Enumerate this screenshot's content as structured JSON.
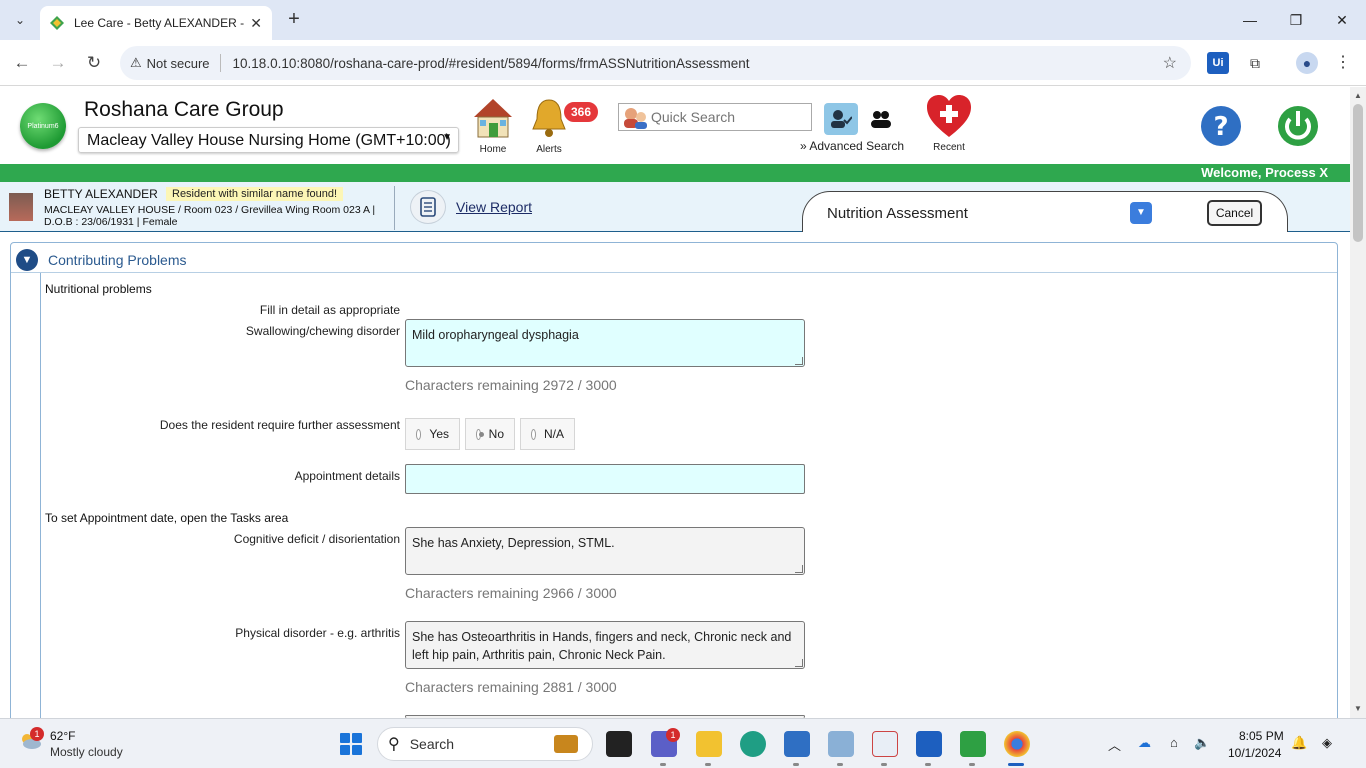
{
  "browser": {
    "tab_title": "Lee Care - Betty ALEXANDER - ",
    "security_label": "Not secure",
    "url": "10.18.0.10:8080/roshana-care-prod/#resident/5894/forms/frmASSNutritionAssessment"
  },
  "header": {
    "logo_text": "Platinum6",
    "org_name": "Roshana Care Group",
    "facility": "Macleay Valley House Nursing Home (GMT+10:00)",
    "home_label": "Home",
    "alerts_label": "Alerts",
    "alerts_count": "366",
    "quick_search_placeholder": "Quick Search",
    "advanced_search_label": "Advanced Search",
    "recent_label": "Recent"
  },
  "welcome": "Welcome, Process X",
  "resident": {
    "name": "BETTY ALEXANDER",
    "warning": "Resident with similar name found!",
    "location": "MACLEAY VALLEY HOUSE / Room 023 / Grevillea Wing Room 023 A | D.O.B : 23/06/1931 | Female",
    "view_report": "View Report"
  },
  "form": {
    "title": "Nutrition Assessment",
    "cancel_label": "Cancel"
  },
  "section": {
    "title": "Contributing Problems",
    "subtitle": "Nutritional problems",
    "fill_in_note": "Fill in detail as appropriate",
    "swallowing_label": "Swallowing/chewing disorder",
    "swallowing_value": "Mild oropharyngeal dysphagia",
    "swallowing_chars": "Characters remaining 2972 / 3000",
    "further_assessment_label": "Does the resident require further assessment",
    "radio_options": [
      "Yes",
      "No",
      "N/A"
    ],
    "radio_selected": "No",
    "appointment_label": "Appointment details",
    "appointment_value": "",
    "tasks_note": "To set Appointment date, open the Tasks area",
    "cognitive_label": "Cognitive deficit / disorientation",
    "cognitive_value": "She has Anxiety, Depression, STML.",
    "cognitive_chars": "Characters remaining 2966 / 3000",
    "physical_label": "Physical disorder - e.g. arthritis",
    "physical_value": "She has Osteoarthritis  in Hands, fingers and neck, Chronic neck and left hip pain, Arthritis pain, Chronic Neck Pain.",
    "physical_chars": "Characters remaining 2881 / 3000"
  },
  "taskbar": {
    "weather_temp": "62°F",
    "weather_desc": "Mostly cloudy",
    "weather_badge": "1",
    "search_placeholder": "Search",
    "teams_badge": "1",
    "time": "8:05 PM",
    "date": "10/1/2024"
  },
  "colors": {
    "green_bar": "#2fa84f",
    "textarea_cyan": "#e0ffff",
    "section_title": "#2b5a8f",
    "badge_red": "#e5383b"
  }
}
